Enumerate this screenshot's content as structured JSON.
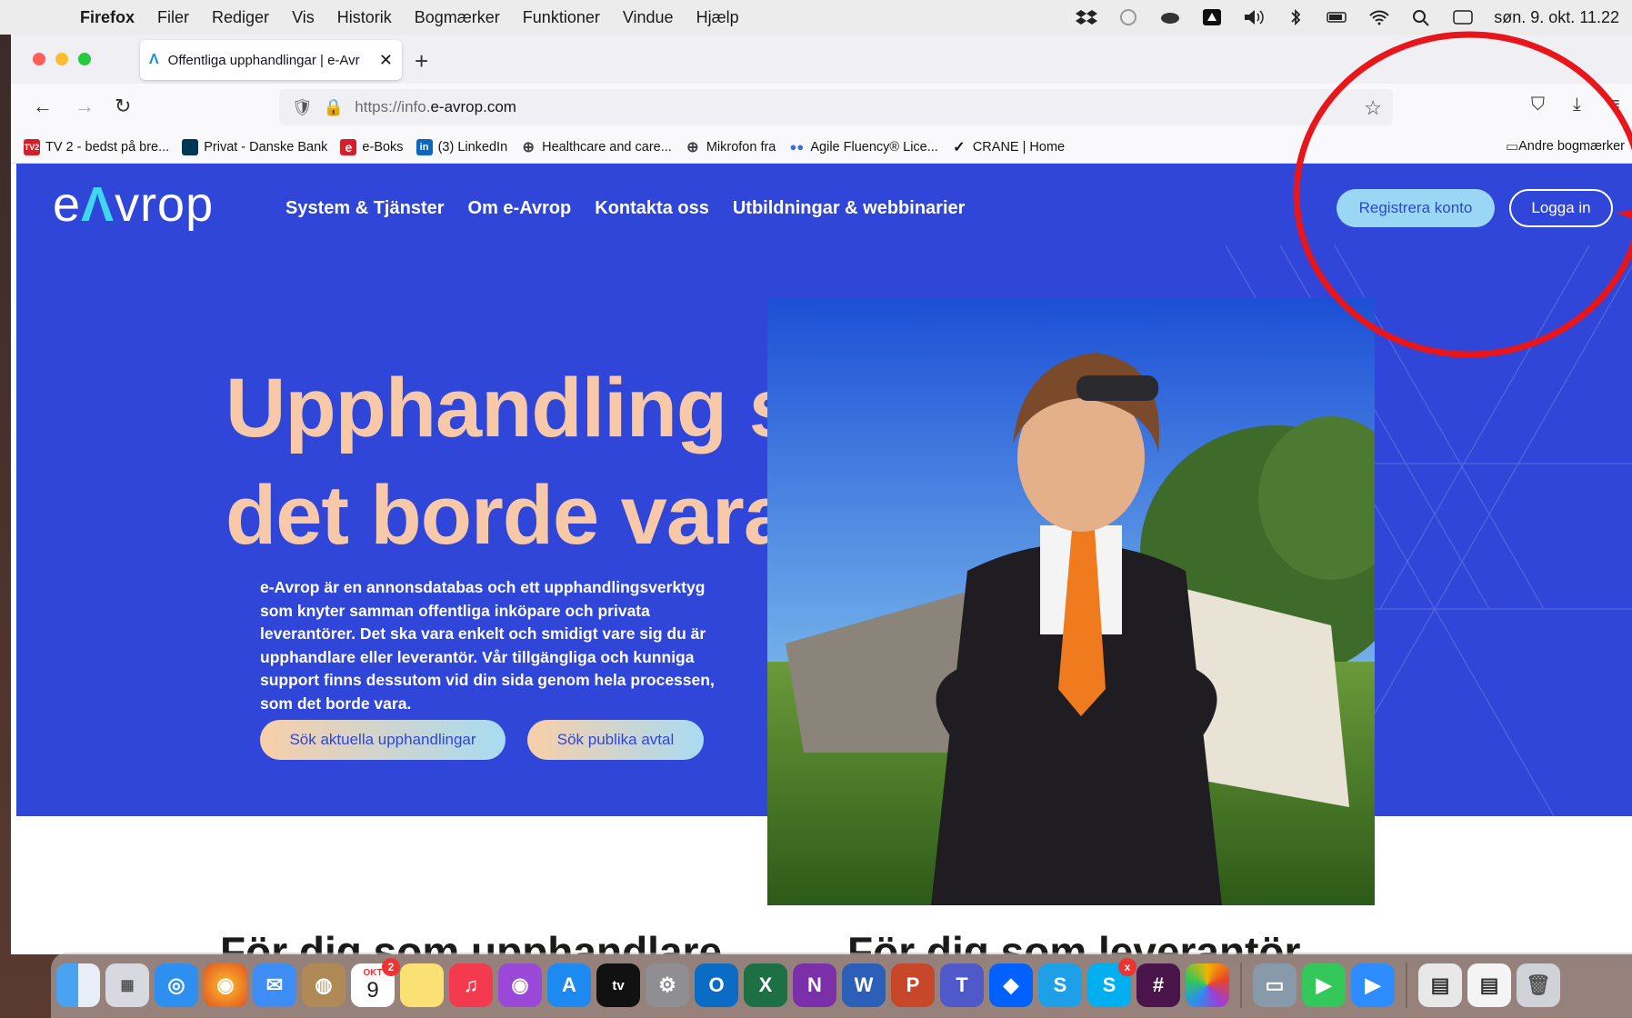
{
  "menubar": {
    "app": "Firefox",
    "items": [
      "Filer",
      "Rediger",
      "Vis",
      "Historik",
      "Bogmærker",
      "Funktioner",
      "Vindue",
      "Hjælp"
    ],
    "clock": "søn. 9. okt. 11.22"
  },
  "browser": {
    "tab_title": "Offentliga upphandlingar | e-Avr",
    "url_prefix": "https://info.",
    "url_domain": "e-avrop.com",
    "bookmarks": [
      {
        "label": "TV 2 - bedst på bre...",
        "icon": "tv2-icon",
        "color": "#d4202c",
        "glyph": "TV2"
      },
      {
        "label": "Privat - Danske Bank",
        "icon": "danske-bank-icon",
        "color": "#003755",
        "glyph": ""
      },
      {
        "label": "e-Boks",
        "icon": "eboks-icon",
        "color": "#d4202c",
        "glyph": "e"
      },
      {
        "label": "(3) LinkedIn",
        "icon": "linkedin-icon",
        "color": "#0a66c2",
        "glyph": "in"
      },
      {
        "label": "Healthcare and care...",
        "icon": "globe-icon",
        "color": "",
        "glyph": "⊕"
      },
      {
        "label": "Mikrofon fra",
        "icon": "globe-icon",
        "color": "",
        "glyph": "⊕"
      },
      {
        "label": "Agile Fluency® Lice...",
        "icon": "people-icon",
        "color": "",
        "glyph": "👥"
      },
      {
        "label": "CRANE | Home",
        "icon": "crane-icon",
        "color": "",
        "glyph": "✓"
      }
    ],
    "other_bookmarks": "Andre bogmærker"
  },
  "site": {
    "logo": {
      "e": "e",
      "a": "Λ",
      "rest": "vrop"
    },
    "nav": [
      "System & Tjänster",
      "Om e-Avrop",
      "Kontakta oss",
      "Utbildningar & webbinarier"
    ],
    "register": "Registrera konto",
    "login": "Logga in",
    "headline_1": "Upphandling som",
    "headline_2": "det borde vara",
    "intro": "e-Avrop är en annonsdatabas och ett upphandlingsverktyg som knyter samman offentliga inköpare och privata leverantörer. Det ska vara enkelt och smidigt vare sig du är upphandlare eller leverantör. Vår tillgängliga och kunniga support finns dessutom vid din sida genom hela processen, som det borde vara.",
    "cta_1": "Sök aktuella upphandlingar",
    "cta_2": "Sök publika avtal",
    "below_1": "För dig som upphandlare",
    "below_2": "För dig som leverantör"
  },
  "dock": {
    "calendar_month": "OKT",
    "calendar_day": "9",
    "calendar_badge": "2",
    "skype_badge": "x"
  },
  "colors": {
    "hero": "#2f46d8",
    "headline": "#f7c9a8",
    "annotation": "#e8151b"
  }
}
